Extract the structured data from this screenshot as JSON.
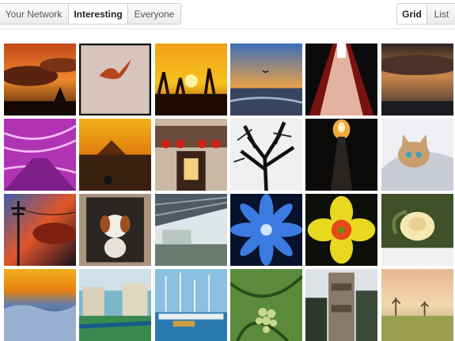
{
  "filters": {
    "items": [
      {
        "label": "Your Network",
        "active": false
      },
      {
        "label": "Interesting",
        "active": true
      },
      {
        "label": "Everyone",
        "active": false
      }
    ]
  },
  "view": {
    "items": [
      {
        "label": "Grid",
        "active": true
      },
      {
        "label": "List",
        "active": false
      }
    ]
  },
  "photos": [
    {
      "name": "photo-orange-sunset-clouds",
      "icon": "sunset-clouds"
    },
    {
      "name": "photo-seagull-flying",
      "icon": "seagull"
    },
    {
      "name": "photo-sunset-silhouette-plants",
      "icon": "sunset-plants"
    },
    {
      "name": "photo-bay-sunset-with-bird",
      "icon": "bay-sunset"
    },
    {
      "name": "photo-red-bridge-walkway",
      "icon": "red-bridge"
    },
    {
      "name": "photo-dramatic-sky-clouds",
      "icon": "dramatic-sky"
    },
    {
      "name": "photo-purple-tunnel-light",
      "icon": "purple-tunnel"
    },
    {
      "name": "photo-mountain-golden-sunset",
      "icon": "mountain-sunset"
    },
    {
      "name": "photo-red-lantern-shop",
      "icon": "lantern-shop"
    },
    {
      "name": "photo-black-white-tree",
      "icon": "bw-tree"
    },
    {
      "name": "photo-night-road-glow",
      "icon": "night-road"
    },
    {
      "name": "photo-cat-under-blanket",
      "icon": "cat"
    },
    {
      "name": "photo-power-lines-red-sky",
      "icon": "power-lines"
    },
    {
      "name": "photo-puppy-dog",
      "icon": "dog"
    },
    {
      "name": "photo-train-station-platform",
      "icon": "station"
    },
    {
      "name": "photo-blue-flower",
      "icon": "blue-flower"
    },
    {
      "name": "photo-yellow-flower",
      "icon": "yellow-flower"
    },
    {
      "name": "photo-white-rose",
      "icon": "white-rose"
    },
    {
      "name": "photo-sunrise-above-clouds",
      "icon": "sunrise-clouds"
    },
    {
      "name": "photo-canal-houses",
      "icon": "canal"
    },
    {
      "name": "photo-harbor-sailboats",
      "icon": "harbor"
    },
    {
      "name": "photo-grapes-vine",
      "icon": "grapes"
    },
    {
      "name": "photo-totem-pole",
      "icon": "totem"
    },
    {
      "name": "photo-hazy-field-trees",
      "icon": "hazy-field"
    }
  ]
}
